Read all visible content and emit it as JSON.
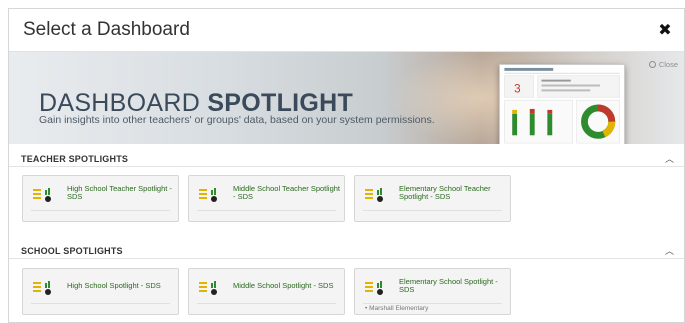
{
  "modal": {
    "title": "Select a Dashboard"
  },
  "banner": {
    "title_light": "DASHBOARD ",
    "title_bold": "SPOTLIGHT",
    "subtitle": "Gain insights into other teachers' or groups' data, based on your system permissions.",
    "close_label": "Close"
  },
  "sections": [
    {
      "title": "TEACHER SPOTLIGHTS",
      "cards": [
        {
          "label": "High School Teacher Spotlight - SDS",
          "sub": ""
        },
        {
          "label": "Middle School Teacher Spotlight - SDS",
          "sub": ""
        },
        {
          "label": "Elementary School Teacher Spotlight - SDS",
          "sub": ""
        }
      ]
    },
    {
      "title": "SCHOOL SPOTLIGHTS",
      "cards": [
        {
          "label": "High School Spotlight - SDS",
          "sub": ""
        },
        {
          "label": "Middle School Spotlight - SDS",
          "sub": ""
        },
        {
          "label": "Elementary School Spotlight - SDS",
          "sub": "• Marshall Elementary"
        }
      ]
    }
  ],
  "colors": {
    "accent_green": "#2a6a1e",
    "icon_yellow": "#e0b400",
    "icon_dark": "#222222"
  }
}
